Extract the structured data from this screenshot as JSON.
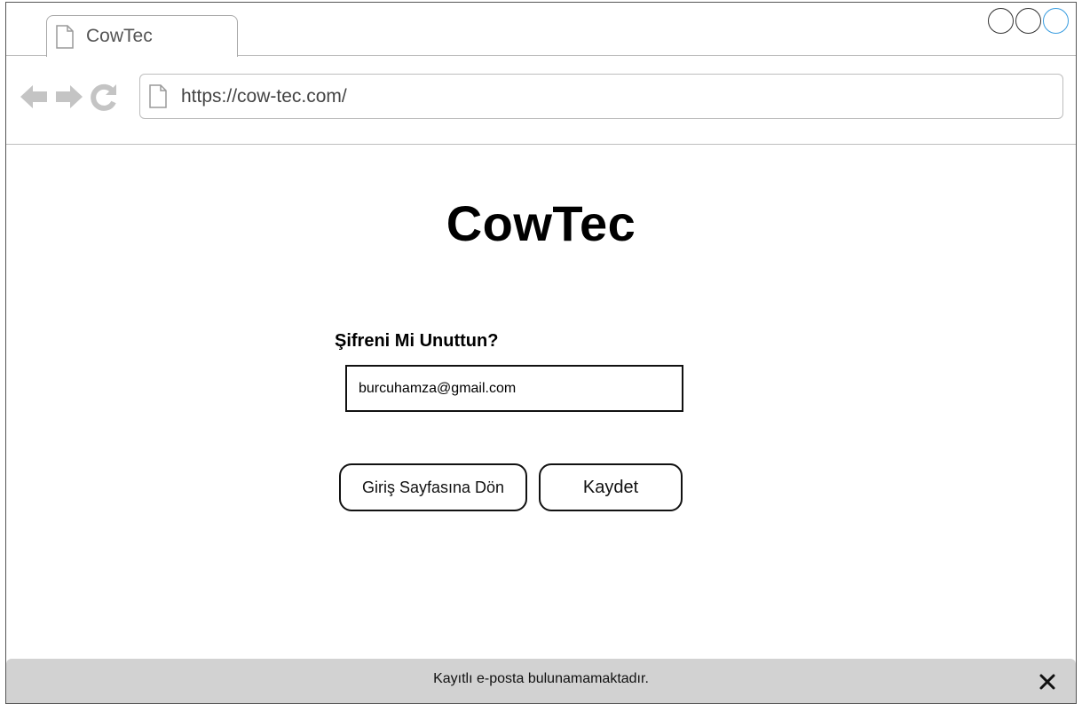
{
  "browser": {
    "tab_title": "CowTec",
    "url": "https://cow-tec.com/"
  },
  "page": {
    "app_title": "CowTec",
    "form_heading": "Şifreni Mi Unuttun?",
    "email_value": "burcuhamza@gmail.com",
    "back_button_label": "Giriş Sayfasına Dön",
    "save_button_label": "Kaydet"
  },
  "toast": {
    "message": "Kayıtlı e-posta bulunamamaktadır."
  },
  "colors": {
    "accent_circle": "#3a9de0",
    "toast_background": "#d2d2d2"
  },
  "icons": [
    "page-icon",
    "back-arrow-icon",
    "forward-arrow-icon",
    "reload-icon",
    "close-icon"
  ]
}
